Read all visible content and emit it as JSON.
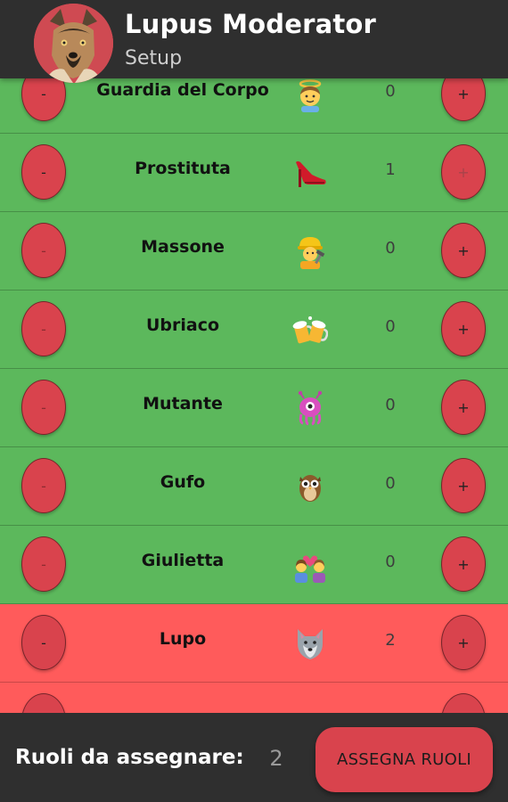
{
  "header": {
    "title": "Lupus Moderator",
    "subtitle": "Setup"
  },
  "roles": [
    {
      "name": "Guardia del Corpo",
      "icon": "angel-icon",
      "count": "0",
      "team": "village",
      "minus": "-",
      "plus": "+"
    },
    {
      "name": "Prostituta",
      "icon": "high-heel-icon",
      "count": "1",
      "team": "village",
      "minus": "-",
      "plus": "+"
    },
    {
      "name": "Massone",
      "icon": "construction-worker-icon",
      "count": "0",
      "team": "village",
      "minus": "-",
      "plus": "+"
    },
    {
      "name": "Ubriaco",
      "icon": "beer-mugs-icon",
      "count": "0",
      "team": "village",
      "minus": "-",
      "plus": "+"
    },
    {
      "name": "Mutante",
      "icon": "alien-monster-icon",
      "count": "0",
      "team": "village",
      "minus": "-",
      "plus": "+"
    },
    {
      "name": "Gufo",
      "icon": "owl-icon",
      "count": "0",
      "team": "village",
      "minus": "-",
      "plus": "+"
    },
    {
      "name": "Giulietta",
      "icon": "couple-heart-icon",
      "count": "0",
      "team": "village",
      "minus": "-",
      "plus": "+"
    },
    {
      "name": "Lupo",
      "icon": "wolf-icon",
      "count": "2",
      "team": "wolf",
      "minus": "-",
      "plus": "+"
    }
  ],
  "colors": {
    "village_row": "#5cb85c",
    "wolf_row": "#ff5b5b",
    "button": "#d9434d",
    "bar": "#2f2f2f"
  },
  "footer": {
    "label": "Ruoli da assegnare:",
    "remaining": "2",
    "assign_label": "ASSEGNA RUOLI"
  }
}
